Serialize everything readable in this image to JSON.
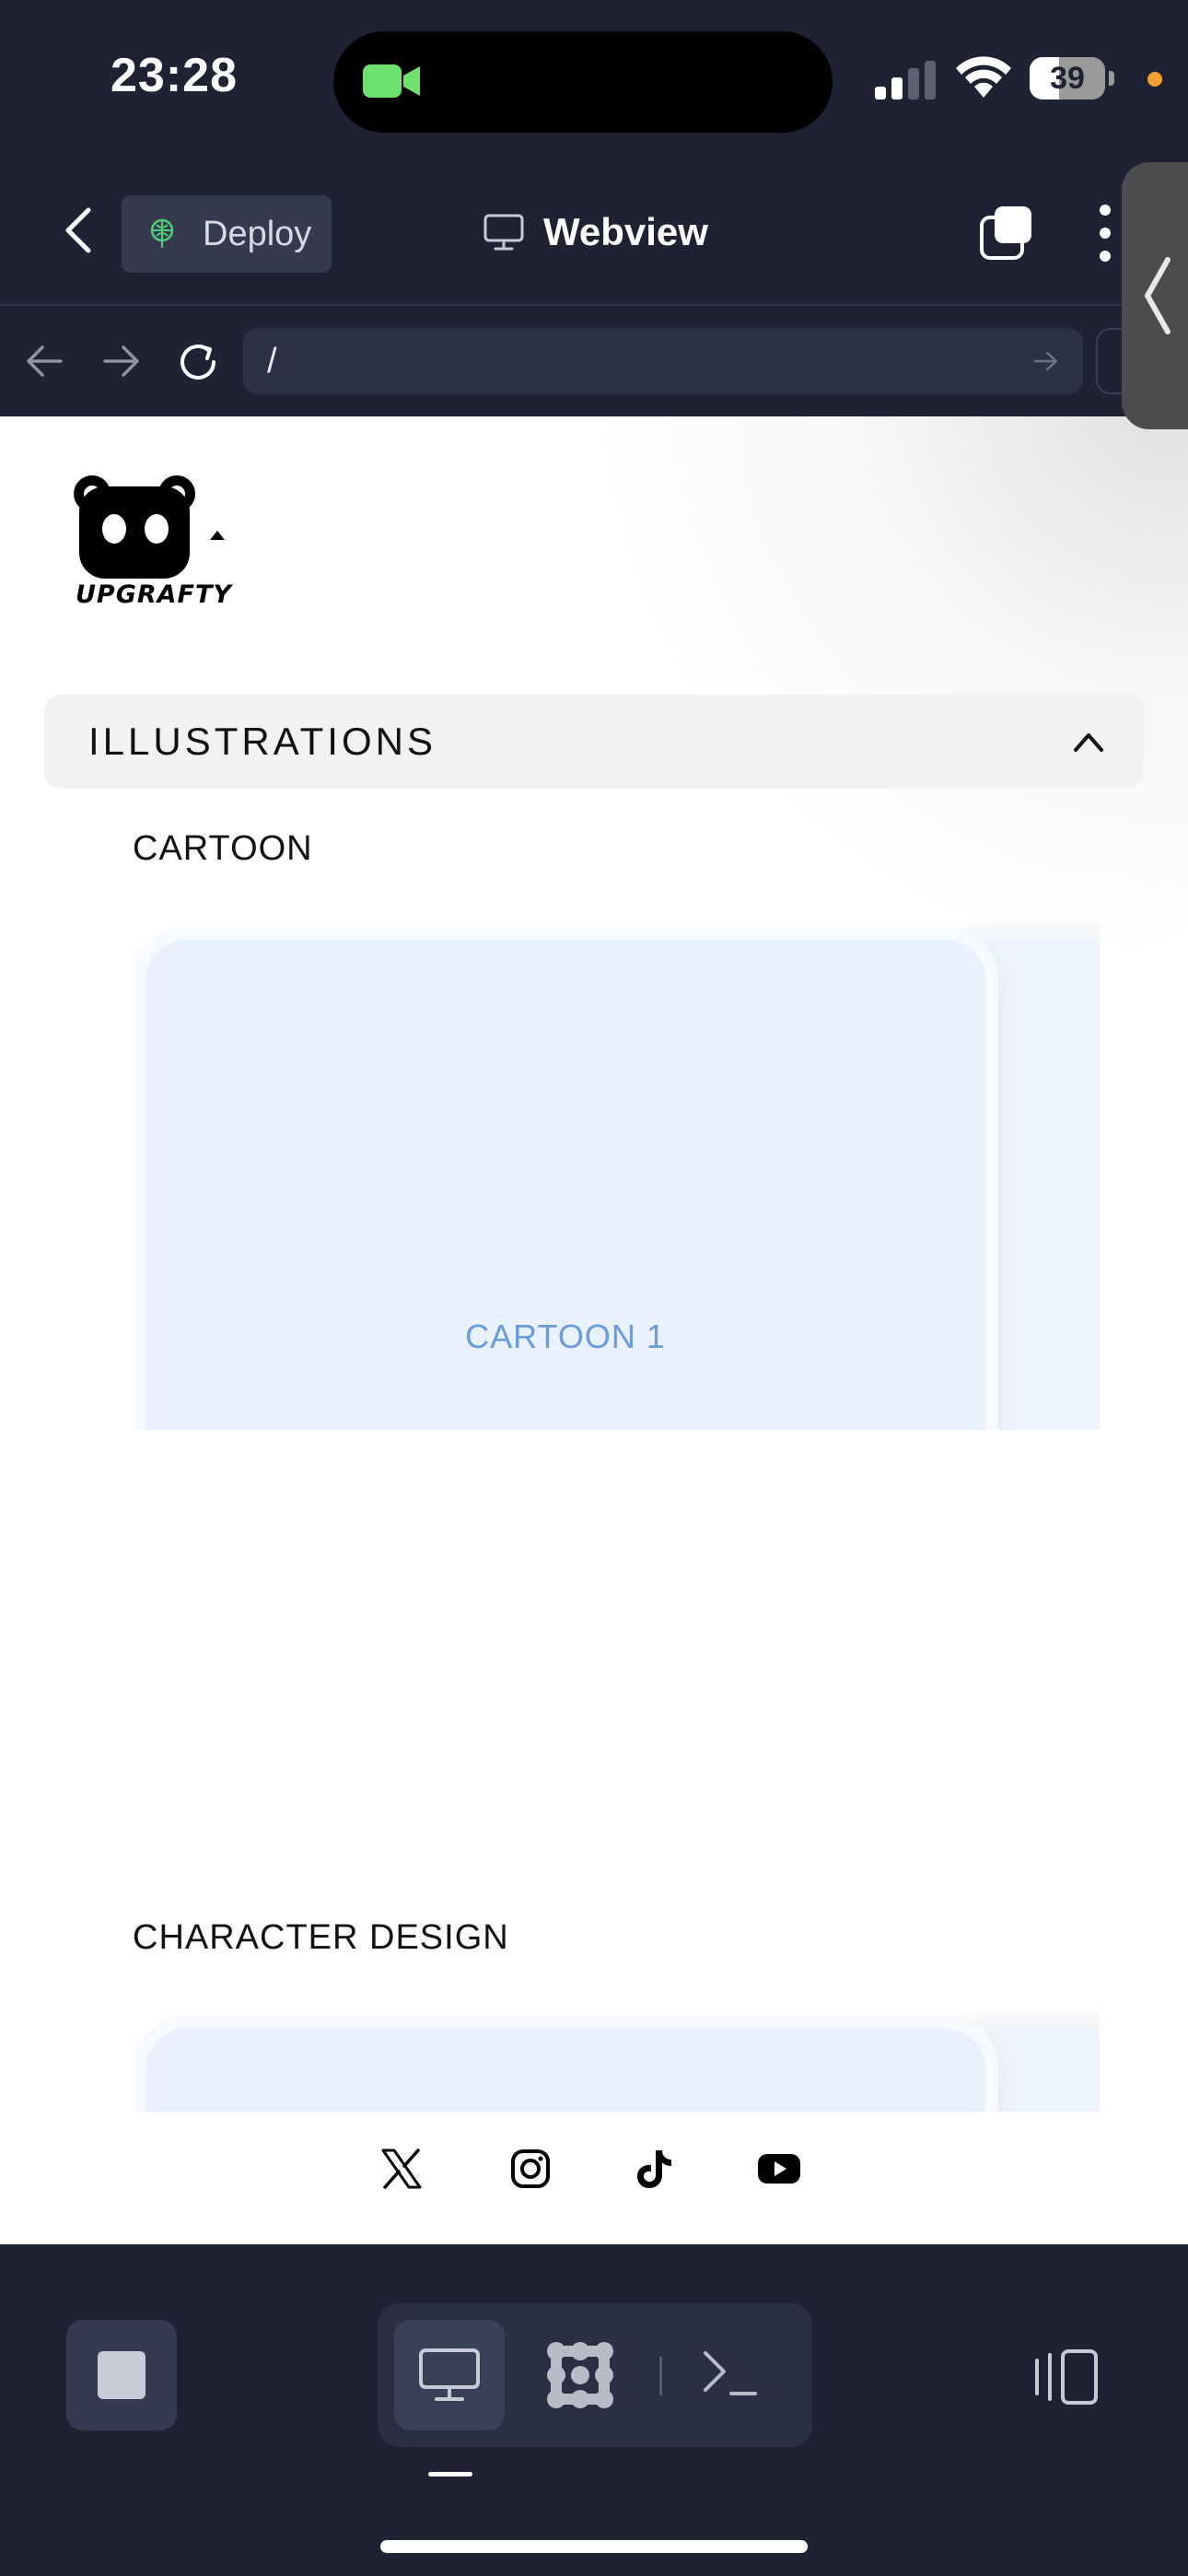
{
  "status_bar": {
    "time": "23:28",
    "battery_percent": 39,
    "battery_text": "39",
    "camera_indicator_color": "#6ee06e",
    "privacy_dot_color": "#f5a030"
  },
  "header": {
    "back_icon": "chevron-left-icon",
    "deploy_label": "Deploy",
    "deploy_icon": "globe-tree-icon",
    "title": "Webview",
    "title_icon": "monitor-icon",
    "tabs_icon": "tabs-icon",
    "more_icon": "more-vertical-icon"
  },
  "url_bar": {
    "url": "/"
  },
  "web": {
    "logo_text": "UPGRAFTY",
    "accordion_title": "ILLUSTRATIONS",
    "sections": [
      {
        "label": "CARTOON",
        "cards": [
          "CARTOON 1"
        ]
      },
      {
        "label": "CHARACTER DESIGN",
        "cards": [
          ""
        ]
      }
    ],
    "social": [
      "x-icon",
      "instagram-icon",
      "tiktok-icon",
      "youtube-icon"
    ]
  },
  "bottom_bar": {
    "stop_icon": "stop-icon",
    "modes": [
      "webview-icon",
      "mesh-icon",
      "terminal-icon"
    ],
    "active_mode": "webview-icon",
    "split_icon": "split-view-icon"
  },
  "colors": {
    "chrome_bg": "#1e2233",
    "card_bg": "#e8f1fd",
    "card_text": "#6a9bdc",
    "accordion_bg": "#f3f2f1"
  }
}
